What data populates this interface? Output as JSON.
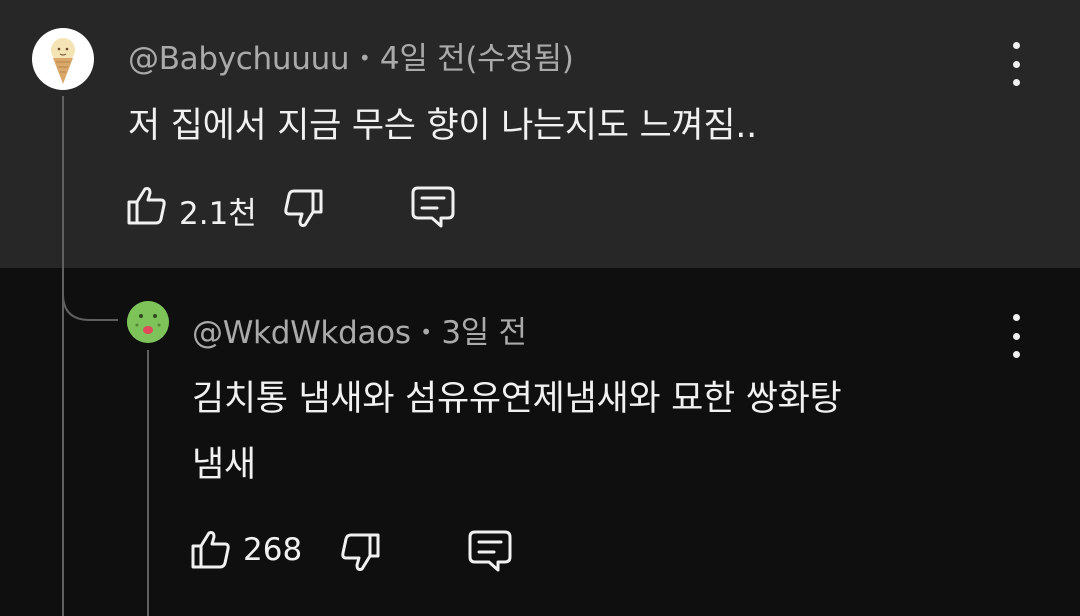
{
  "comments": [
    {
      "author": "@Babychuuuu",
      "separator": "•",
      "time": "4일 전(수정됨)",
      "text": "저 집에서 지금 무슨 향이 나는지도 느껴짐..",
      "likes": "2.1천",
      "avatar_icon": "ice-cream-cone"
    },
    {
      "author": "@WkdWkdaos",
      "separator": "•",
      "time": "3일 전",
      "text_lines": [
        "김치통 냄새와 섬유유연제냄새와 묘한 쌍화탕",
        "냄새"
      ],
      "likes": "268",
      "avatar_icon": "green-character"
    }
  ],
  "icons": {
    "like": "thumbs-up-icon",
    "dislike": "thumbs-down-icon",
    "reply": "comment-icon",
    "more": "more-vertical-icon"
  },
  "colors": {
    "top_background": "#272727",
    "page_background": "#0f0f0f",
    "meta_text": "#aaaaaa",
    "primary_text": "#f1f1f1"
  }
}
